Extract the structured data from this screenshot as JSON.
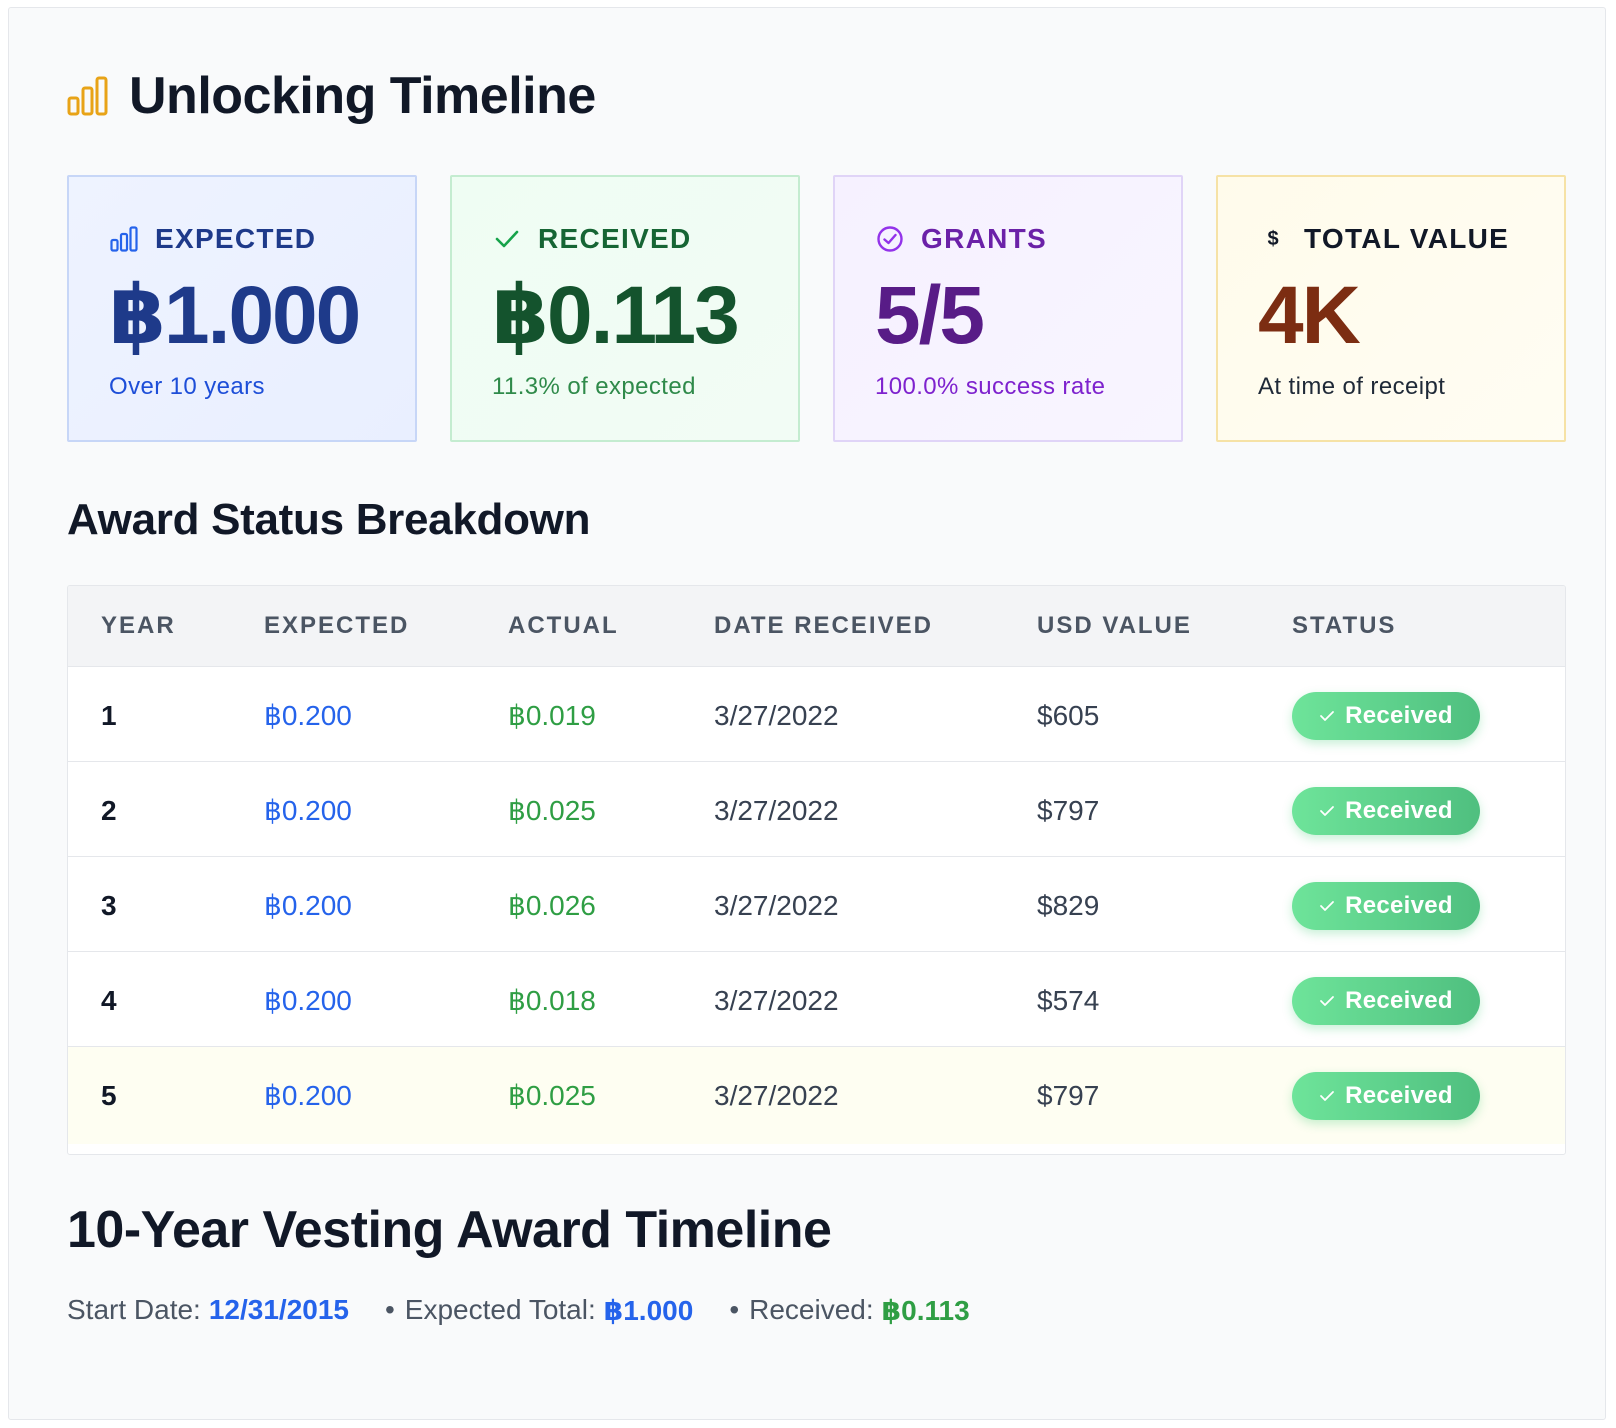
{
  "header": {
    "title": "Unlocking Timeline",
    "icon": "bar-chart-icon",
    "icon_color": "#e8a317"
  },
  "cards": [
    {
      "label": "EXPECTED",
      "value": "฿1.000",
      "sub": "Over 10 years",
      "icon": "bar-chart-icon",
      "accent": "#1e3a8a"
    },
    {
      "label": "RECEIVED",
      "value": "฿0.113",
      "sub": "11.3% of expected",
      "icon": "check-icon",
      "accent": "#14532d"
    },
    {
      "label": "GRANTS",
      "value": "5/5",
      "sub": "100.0% success rate",
      "icon": "check-circle-icon",
      "accent": "#581c87"
    },
    {
      "label": "TOTAL VALUE",
      "value": "4K",
      "sub": "At time of receipt",
      "icon": "dollar-icon",
      "icon_glyph": "$",
      "accent": "#7c2d12"
    }
  ],
  "breakdown": {
    "title": "Award Status Breakdown",
    "columns": [
      "YEAR",
      "EXPECTED",
      "ACTUAL",
      "DATE RECEIVED",
      "USD VALUE",
      "STATUS"
    ],
    "rows": [
      {
        "year": "1",
        "expected": "฿0.200",
        "actual": "฿0.019",
        "date": "3/27/2022",
        "usd": "$605",
        "status": "Received"
      },
      {
        "year": "2",
        "expected": "฿0.200",
        "actual": "฿0.025",
        "date": "3/27/2022",
        "usd": "$797",
        "status": "Received"
      },
      {
        "year": "3",
        "expected": "฿0.200",
        "actual": "฿0.026",
        "date": "3/27/2022",
        "usd": "$829",
        "status": "Received"
      },
      {
        "year": "4",
        "expected": "฿0.200",
        "actual": "฿0.018",
        "date": "3/27/2022",
        "usd": "$574",
        "status": "Received"
      },
      {
        "year": "5",
        "expected": "฿0.200",
        "actual": "฿0.025",
        "date": "3/27/2022",
        "usd": "$797",
        "status": "Received"
      }
    ],
    "status_color": "#4fbf7f"
  },
  "timeline": {
    "title": "10-Year Vesting Award Timeline",
    "start_label": "Start Date:",
    "start_value": "12/31/2015",
    "expected_label": "Expected Total:",
    "expected_value": "฿1.000",
    "received_label": "Received:",
    "received_value": "฿0.113",
    "separator": "•"
  }
}
